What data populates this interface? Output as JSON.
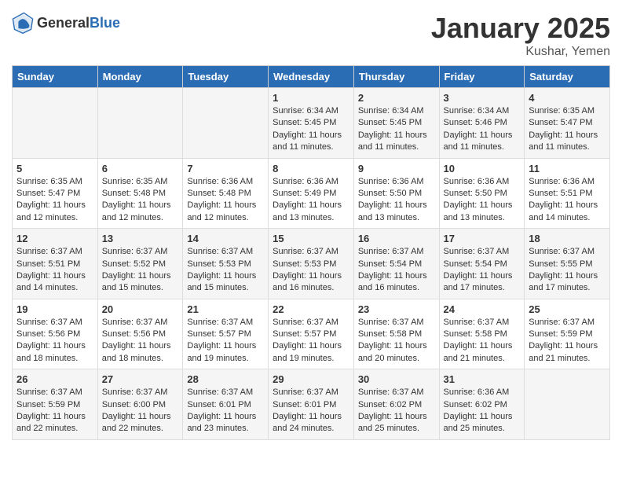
{
  "header": {
    "logo_general": "General",
    "logo_blue": "Blue",
    "month_year": "January 2025",
    "location": "Kushar, Yemen"
  },
  "days_of_week": [
    "Sunday",
    "Monday",
    "Tuesday",
    "Wednesday",
    "Thursday",
    "Friday",
    "Saturday"
  ],
  "weeks": [
    [
      {
        "day": "",
        "info": ""
      },
      {
        "day": "",
        "info": ""
      },
      {
        "day": "",
        "info": ""
      },
      {
        "day": "1",
        "info": "Sunrise: 6:34 AM\nSunset: 5:45 PM\nDaylight: 11 hours and 11 minutes."
      },
      {
        "day": "2",
        "info": "Sunrise: 6:34 AM\nSunset: 5:45 PM\nDaylight: 11 hours and 11 minutes."
      },
      {
        "day": "3",
        "info": "Sunrise: 6:34 AM\nSunset: 5:46 PM\nDaylight: 11 hours and 11 minutes."
      },
      {
        "day": "4",
        "info": "Sunrise: 6:35 AM\nSunset: 5:47 PM\nDaylight: 11 hours and 11 minutes."
      }
    ],
    [
      {
        "day": "5",
        "info": "Sunrise: 6:35 AM\nSunset: 5:47 PM\nDaylight: 11 hours and 12 minutes."
      },
      {
        "day": "6",
        "info": "Sunrise: 6:35 AM\nSunset: 5:48 PM\nDaylight: 11 hours and 12 minutes."
      },
      {
        "day": "7",
        "info": "Sunrise: 6:36 AM\nSunset: 5:48 PM\nDaylight: 11 hours and 12 minutes."
      },
      {
        "day": "8",
        "info": "Sunrise: 6:36 AM\nSunset: 5:49 PM\nDaylight: 11 hours and 13 minutes."
      },
      {
        "day": "9",
        "info": "Sunrise: 6:36 AM\nSunset: 5:50 PM\nDaylight: 11 hours and 13 minutes."
      },
      {
        "day": "10",
        "info": "Sunrise: 6:36 AM\nSunset: 5:50 PM\nDaylight: 11 hours and 13 minutes."
      },
      {
        "day": "11",
        "info": "Sunrise: 6:36 AM\nSunset: 5:51 PM\nDaylight: 11 hours and 14 minutes."
      }
    ],
    [
      {
        "day": "12",
        "info": "Sunrise: 6:37 AM\nSunset: 5:51 PM\nDaylight: 11 hours and 14 minutes."
      },
      {
        "day": "13",
        "info": "Sunrise: 6:37 AM\nSunset: 5:52 PM\nDaylight: 11 hours and 15 minutes."
      },
      {
        "day": "14",
        "info": "Sunrise: 6:37 AM\nSunset: 5:53 PM\nDaylight: 11 hours and 15 minutes."
      },
      {
        "day": "15",
        "info": "Sunrise: 6:37 AM\nSunset: 5:53 PM\nDaylight: 11 hours and 16 minutes."
      },
      {
        "day": "16",
        "info": "Sunrise: 6:37 AM\nSunset: 5:54 PM\nDaylight: 11 hours and 16 minutes."
      },
      {
        "day": "17",
        "info": "Sunrise: 6:37 AM\nSunset: 5:54 PM\nDaylight: 11 hours and 17 minutes."
      },
      {
        "day": "18",
        "info": "Sunrise: 6:37 AM\nSunset: 5:55 PM\nDaylight: 11 hours and 17 minutes."
      }
    ],
    [
      {
        "day": "19",
        "info": "Sunrise: 6:37 AM\nSunset: 5:56 PM\nDaylight: 11 hours and 18 minutes."
      },
      {
        "day": "20",
        "info": "Sunrise: 6:37 AM\nSunset: 5:56 PM\nDaylight: 11 hours and 18 minutes."
      },
      {
        "day": "21",
        "info": "Sunrise: 6:37 AM\nSunset: 5:57 PM\nDaylight: 11 hours and 19 minutes."
      },
      {
        "day": "22",
        "info": "Sunrise: 6:37 AM\nSunset: 5:57 PM\nDaylight: 11 hours and 19 minutes."
      },
      {
        "day": "23",
        "info": "Sunrise: 6:37 AM\nSunset: 5:58 PM\nDaylight: 11 hours and 20 minutes."
      },
      {
        "day": "24",
        "info": "Sunrise: 6:37 AM\nSunset: 5:58 PM\nDaylight: 11 hours and 21 minutes."
      },
      {
        "day": "25",
        "info": "Sunrise: 6:37 AM\nSunset: 5:59 PM\nDaylight: 11 hours and 21 minutes."
      }
    ],
    [
      {
        "day": "26",
        "info": "Sunrise: 6:37 AM\nSunset: 5:59 PM\nDaylight: 11 hours and 22 minutes."
      },
      {
        "day": "27",
        "info": "Sunrise: 6:37 AM\nSunset: 6:00 PM\nDaylight: 11 hours and 22 minutes."
      },
      {
        "day": "28",
        "info": "Sunrise: 6:37 AM\nSunset: 6:01 PM\nDaylight: 11 hours and 23 minutes."
      },
      {
        "day": "29",
        "info": "Sunrise: 6:37 AM\nSunset: 6:01 PM\nDaylight: 11 hours and 24 minutes."
      },
      {
        "day": "30",
        "info": "Sunrise: 6:37 AM\nSunset: 6:02 PM\nDaylight: 11 hours and 25 minutes."
      },
      {
        "day": "31",
        "info": "Sunrise: 6:36 AM\nSunset: 6:02 PM\nDaylight: 11 hours and 25 minutes."
      },
      {
        "day": "",
        "info": ""
      }
    ]
  ]
}
